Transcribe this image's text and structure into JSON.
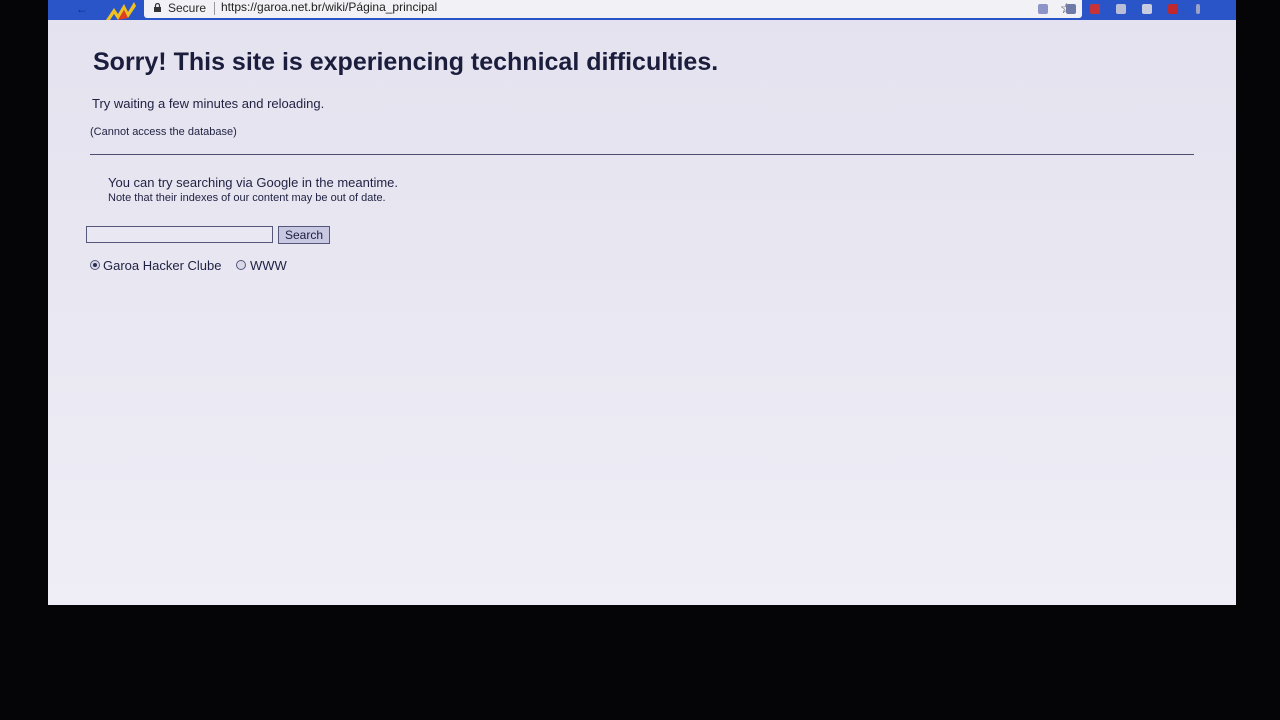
{
  "browser": {
    "secure_label": "Secure",
    "url": "https://garoa.net.br/wiki/Página_principal"
  },
  "error_page": {
    "title": "Sorry! This site is experiencing technical difficulties.",
    "retry_message": "Try waiting a few minutes and reloading.",
    "error_detail": "(Cannot access the database)",
    "google_hint": "You can try searching via Google in the meantime.",
    "outdated_note": "Note that their indexes of our content may be out of date."
  },
  "search": {
    "input_value": "",
    "button_label": "Search",
    "options": [
      {
        "label": "Garoa Hacker Clube",
        "selected": true
      },
      {
        "label": "WWW",
        "selected": false
      }
    ]
  },
  "colors": {
    "browser_bar": "#2a55c8",
    "page_background": "#e8e6f1",
    "text": "#1e2142"
  }
}
